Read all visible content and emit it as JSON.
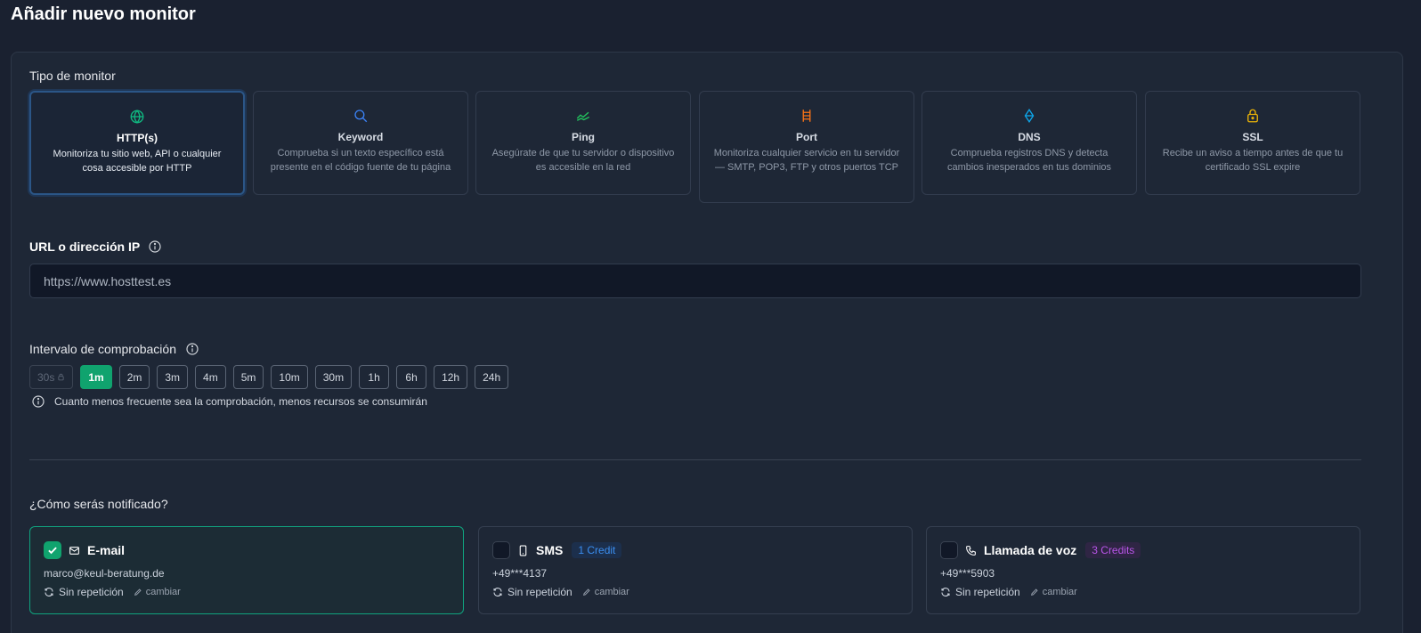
{
  "page": {
    "title": "Añadir nuevo monitor"
  },
  "monitor_type": {
    "label": "Tipo de monitor",
    "options": [
      {
        "icon": "globe-icon",
        "name": "HTTP(s)",
        "description": "Monitoriza tu sitio web, API o cualquier cosa accesible por HTTP",
        "selected": true,
        "icon_color": "#10b981"
      },
      {
        "icon": "search-icon",
        "name": "Keyword",
        "description": "Comprueba si un texto específico está presente en el código fuente de tu página",
        "selected": false,
        "icon_color": "#3b82f6"
      },
      {
        "icon": "ping-icon",
        "name": "Ping",
        "description": "Asegúrate de que tu servidor o dispositivo es accesible en la red",
        "selected": false,
        "icon_color": "#22c55e"
      },
      {
        "icon": "port-icon",
        "name": "Port",
        "description": "Monitoriza cualquier servicio en tu servidor — SMTP, POP3, FTP y otros puertos TCP",
        "selected": false,
        "icon_color": "#f97316"
      },
      {
        "icon": "dns-icon",
        "name": "DNS",
        "description": "Comprueba registros DNS y detecta cambios inesperados en tus dominios",
        "selected": false,
        "icon_color": "#0ea5e9"
      },
      {
        "icon": "lock-icon",
        "name": "SSL",
        "description": "Recibe un aviso a tiempo antes de que tu certificado SSL expire",
        "selected": false,
        "icon_color": "#eab308"
      }
    ]
  },
  "url": {
    "label": "URL o dirección IP",
    "value": "https://www.hosttest.es"
  },
  "interval": {
    "label": "Intervalo de comprobación",
    "options": [
      "30s",
      "1m",
      "2m",
      "3m",
      "4m",
      "5m",
      "10m",
      "30m",
      "1h",
      "6h",
      "12h",
      "24h"
    ],
    "selected": "1m",
    "locked": [
      "30s"
    ],
    "note": "Cuanto menos frecuente sea la comprobación, menos recursos se consumirán"
  },
  "notifications": {
    "label": "¿Cómo serás notificado?",
    "channels": [
      {
        "icon": "mail-icon",
        "name": "E-mail",
        "badge": "",
        "contact": "marco@keul-beratung.de",
        "repeat": "Sin repetición",
        "change": "cambiar",
        "checked": true
      },
      {
        "icon": "phone-icon",
        "name": "SMS",
        "badge": "1 Credit",
        "contact": "+49***4137",
        "repeat": "Sin repetición",
        "change": "cambiar",
        "checked": false
      },
      {
        "icon": "call-icon",
        "name": "Llamada de voz",
        "badge": "3 Credits",
        "contact": "+49***5903",
        "repeat": "Sin repetición",
        "change": "cambiar",
        "checked": false
      }
    ]
  }
}
